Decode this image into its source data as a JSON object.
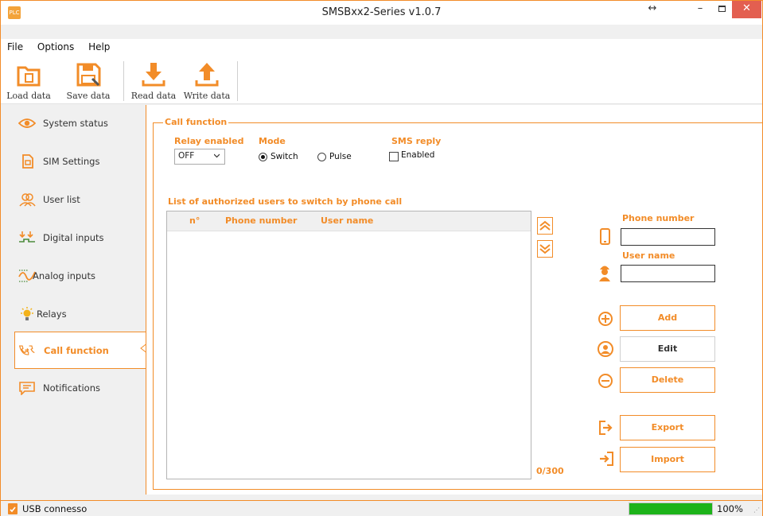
{
  "window": {
    "title": "SMSBxx2-Series v1.0.7",
    "icon_text": "PLC"
  },
  "menu": [
    "File",
    "Options",
    "Help"
  ],
  "toolbar": {
    "load_label": "Load data",
    "save_label": "Save data",
    "read_label": "Read data",
    "write_label": "Write data"
  },
  "sidebar": {
    "items": [
      {
        "label": "System status",
        "icon": "eye-icon"
      },
      {
        "label": "SIM Settings",
        "icon": "sim-card-icon"
      },
      {
        "label": "User list",
        "icon": "users-icon"
      },
      {
        "label": "Digital inputs",
        "icon": "digital-inputs-icon"
      },
      {
        "label": "Analog inputs",
        "icon": "analog-wave-icon"
      },
      {
        "label": "Relays",
        "icon": "bulb-icon"
      },
      {
        "label": "Call function",
        "icon": "call-forward-icon"
      },
      {
        "label": "Notifications",
        "icon": "message-icon"
      }
    ],
    "active_index": 6
  },
  "call_function": {
    "group_title": "Call function",
    "relay_label": "Relay enabled",
    "relay_value": "OFF",
    "mode_label": "Mode",
    "mode_switch": "Switch",
    "mode_pulse": "Pulse",
    "mode_selected": "Switch",
    "sms_label": "SMS reply",
    "sms_checkbox": "Enabled",
    "sms_checked": false,
    "list_title": "List of authorized users to switch by phone call",
    "columns": [
      "n°",
      "Phone number",
      "User name"
    ],
    "rows": [],
    "counter": "0/300",
    "phone_label": "Phone number",
    "phone_value": "",
    "user_label": "User name",
    "user_value": "",
    "buttons": {
      "add": "Add",
      "edit": "Edit",
      "delete": "Delete",
      "export": "Export",
      "import": "Import"
    }
  },
  "status": {
    "connection": "USB connesso",
    "progress_percent": 100,
    "progress_text": "100%"
  },
  "colors": {
    "accent": "#f28c28",
    "progress": "#1db31a",
    "close": "#e35f50"
  }
}
